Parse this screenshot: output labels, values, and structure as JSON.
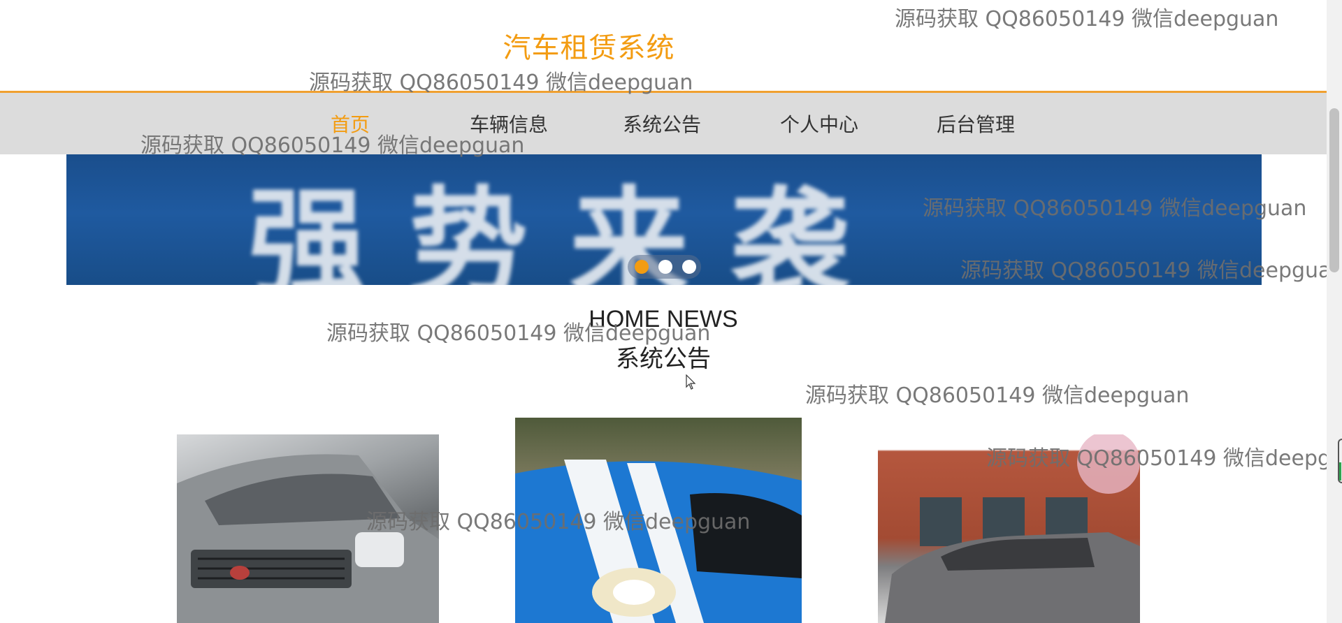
{
  "header": {
    "title": "汽车租赁系统",
    "accent_color": "#f39c12"
  },
  "nav": {
    "items": [
      {
        "label": "首页",
        "active": true
      },
      {
        "label": "车辆信息",
        "active": false
      },
      {
        "label": "系统公告",
        "active": false
      },
      {
        "label": "个人中心",
        "active": false
      },
      {
        "label": "后台管理",
        "active": false
      }
    ]
  },
  "banner": {
    "text": "强势来袭",
    "slides": {
      "count": 3,
      "active_index": 0
    }
  },
  "news": {
    "title_en": "HOME NEWS",
    "title_cn": "系统公告"
  },
  "cars": [
    {
      "name": "silver-sedan-image"
    },
    {
      "name": "blue-sports-car-image"
    },
    {
      "name": "gray-minivan-image"
    }
  ],
  "watermark": {
    "text": "源码获取 QQ86050149 微信deepguan"
  }
}
